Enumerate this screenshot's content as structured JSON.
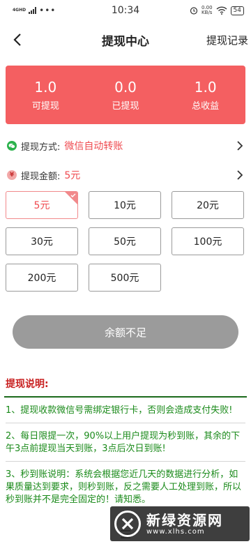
{
  "status_bar": {
    "network": "4GHD",
    "dots": "•••",
    "time": "10:34",
    "speed_value": "0.00",
    "speed_unit": "KB/s",
    "battery": "54"
  },
  "nav": {
    "title": "提现中心",
    "record_label": "提现记录"
  },
  "stats": [
    {
      "value": "1.0",
      "label": "可提现"
    },
    {
      "value": "0.0",
      "label": "已提现"
    },
    {
      "value": "1.0",
      "label": "总收益"
    }
  ],
  "method": {
    "label": "提现方式:",
    "value": "微信自动转账"
  },
  "amount": {
    "label": "提现金额:",
    "value": "5元"
  },
  "amount_options": [
    "5元",
    "10元",
    "20元",
    "30元",
    "50元",
    "100元",
    "200元",
    "500元"
  ],
  "selected_amount": "5元",
  "submit_label": "余额不足",
  "explain": {
    "title": "提现说明:",
    "notes": [
      "1、提现收款微信号需绑定银行卡，否则会造成支付失败!",
      "2、每日限提一次，90%以上用户提现为秒到账，其余的下午3点前提现当天到账，3点后次日到账!",
      "3、秒到账说明：系统会根据您近几天的数据进行分析，如果质量达到要求，则秒到账，反之需要人工处理到账，所以秒到账并不是完全固定的！请知悉。"
    ]
  },
  "watermark": {
    "name": "新绿资源网",
    "url": "www.xlhs.com"
  },
  "colors": {
    "accent_red": "#f45f61",
    "text_red": "#ef4a4f",
    "note_green": "#1a8a1a",
    "title_red": "#c82020",
    "disabled_gray": "#9b9b9b"
  }
}
